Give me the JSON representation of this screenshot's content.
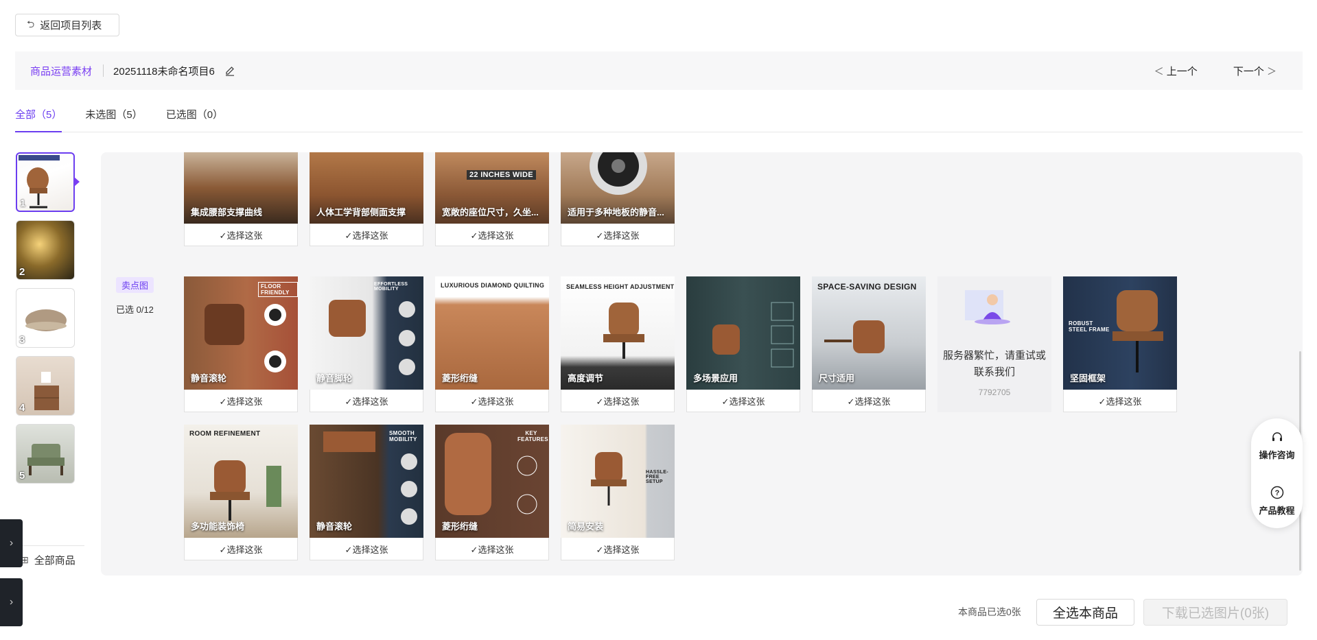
{
  "back_label": "返回项目列表",
  "header": {
    "crumb": "商品运营素材",
    "project": "20251118未命名项目6",
    "prev": "上一个",
    "next": "下一个"
  },
  "tabs": [
    {
      "label": "全部（5）"
    },
    {
      "label": "未选图（5）"
    },
    {
      "label": "已选图（0）"
    }
  ],
  "thumbs": [
    {
      "num": "1"
    },
    {
      "num": "2"
    },
    {
      "num": "3"
    },
    {
      "num": "4"
    },
    {
      "num": "5"
    }
  ],
  "all_products": "全部商品",
  "select_label": "✓选择这张",
  "row0": [
    {
      "caption": "集成腰部支撑曲线",
      "top": ""
    },
    {
      "caption": "人体工学背部侧面支撑",
      "top": ""
    },
    {
      "caption": "宽敞的座位尺寸，久坐...",
      "top": "22 INCHES WIDE"
    },
    {
      "caption": "适用于多种地板的静音...",
      "top": ""
    }
  ],
  "section": {
    "badge": "卖点图",
    "count": "已选 0/12"
  },
  "row1": [
    {
      "caption": "静音滚轮",
      "top": "FLOOR FRIENDLY"
    },
    {
      "caption": "静音脚轮",
      "top": "EFFORTLESS MOBILITY"
    },
    {
      "caption": "菱形绗缝",
      "top": "LUXURIOUS DIAMOND QUILTING"
    },
    {
      "caption": "高度调节",
      "top": "SEAMLESS HEIGHT ADJUSTMENT"
    },
    {
      "caption": "多场景应用",
      "top": ""
    },
    {
      "caption": "尺寸适用",
      "top": "SPACE-SAVING DESIGN"
    },
    {
      "caption": "坚固框架",
      "top": "ROBUST STEEL FRAME"
    }
  ],
  "busy": {
    "msg": "服务器繁忙，请重试或联系我们",
    "code": "7792705"
  },
  "row2": [
    {
      "caption": "多功能装饰椅",
      "top": "ROOM REFINEMENT"
    },
    {
      "caption": "静音滚轮",
      "top": "SMOOTH MOBILITY"
    },
    {
      "caption": "菱形绗缝",
      "top": "KEY FEATURES"
    },
    {
      "caption": "简易安装",
      "top": "HASSLE-FREE SETUP"
    }
  ],
  "float": {
    "consult": "操作咨询",
    "tutorial": "产品教程"
  },
  "footer": {
    "selected_text": "本商品已选0张",
    "select_all": "全选本商品",
    "download": "下载已选图片(0张)"
  }
}
